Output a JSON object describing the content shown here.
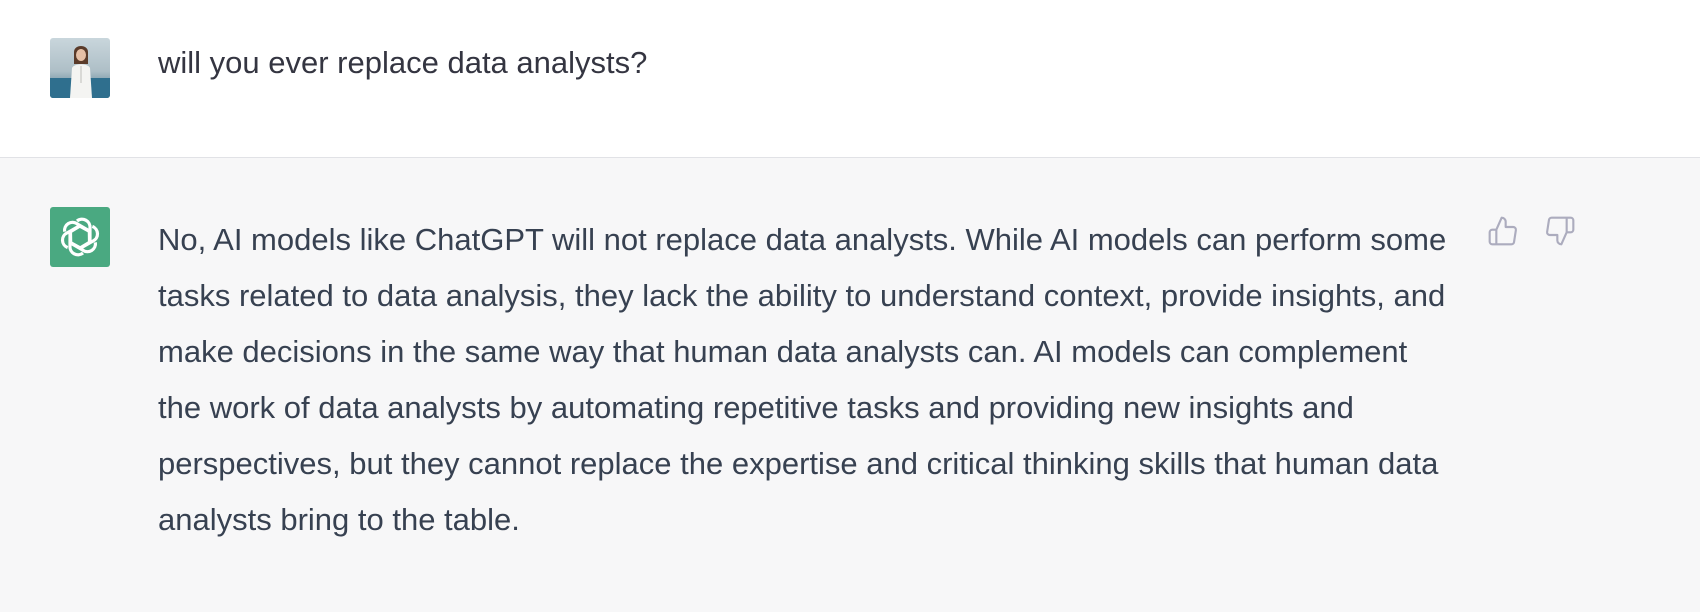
{
  "conversation": {
    "user_message": {
      "avatar_icon": "user-photo-avatar",
      "text": "will you ever replace data analysts?"
    },
    "assistant_message": {
      "avatar_icon": "openai-logo-icon",
      "avatar_color": "#4aa981",
      "text": "No, AI models like ChatGPT will not replace data analysts. While AI models can perform some tasks related to data analysis, they lack the ability to understand context, provide insights, and make decisions in the same way that human data analysts can. AI models can complement the work of data analysts by automating repetitive tasks and providing new insights and perspectives, but they cannot replace the expertise and critical thinking skills that human data analysts bring to the table.",
      "feedback": {
        "up_icon": "thumbs-up-icon",
        "down_icon": "thumbs-down-icon"
      }
    }
  },
  "colors": {
    "user_bg": "#ffffff",
    "assistant_bg": "#f7f7f8",
    "text": "#374151",
    "icon": "#acacbe"
  }
}
